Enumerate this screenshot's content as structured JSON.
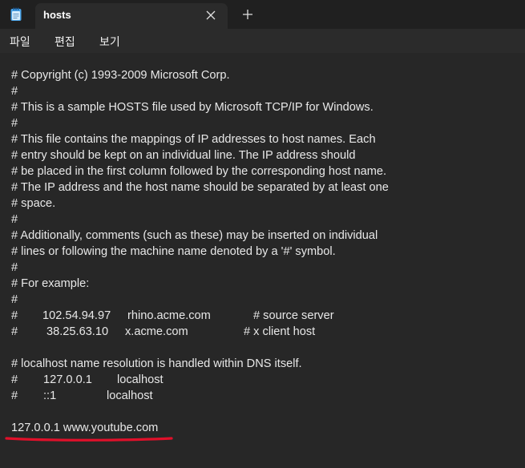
{
  "tab": {
    "title": "hosts"
  },
  "menu": {
    "file": "파일",
    "edit": "편집",
    "view": "보기"
  },
  "colors": {
    "tab_bg": "#202020",
    "editor_bg": "#272727",
    "annotation": "#e0102a",
    "app_icon": "#4aa3e8"
  },
  "icons": {
    "app": "notepad-icon",
    "close": "close-icon",
    "new_tab": "plus-icon"
  },
  "content": {
    "copyright": "# Copyright (c) 1993-2009 Microsoft Corp.",
    "blank1": "#",
    "sample": "# This is a sample HOSTS file used by Microsoft TCP/IP for Windows.",
    "blank2": "#",
    "mapping1": "# This file contains the mappings of IP addresses to host names. Each",
    "mapping2": "# entry should be kept on an individual line. The IP address should",
    "mapping3": "# be placed in the first column followed by the corresponding host name.",
    "mapping4": "# The IP address and the host name should be separated by at least one",
    "mapping5": "# space.",
    "blank3": "#",
    "additional1": "# Additionally, comments (such as these) may be inserted on individual",
    "additional2": "# lines or following the machine name denoted by a '#' symbol.",
    "blank4": "#",
    "example": "# For example:",
    "blank5": "#",
    "ex1": {
      "hash": "#",
      "ip": "102.54.94.97",
      "host": "rhino.acme.com",
      "comment": "# source server"
    },
    "ex2": {
      "hash": "#",
      "ip": "38.25.63.10",
      "host": "x.acme.com",
      "comment": "# x client host"
    },
    "localhost_note": "# localhost name resolution is handled within DNS itself.",
    "lh1": {
      "hash": "#",
      "ip": "127.0.0.1",
      "host": "localhost"
    },
    "lh2": {
      "hash": "#",
      "ip": "::1",
      "host": "localhost"
    },
    "custom_entry": "127.0.0.1 www.youtube.com"
  }
}
